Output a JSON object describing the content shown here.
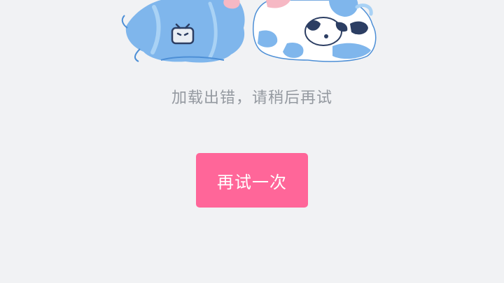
{
  "error_state": {
    "message": "加载出错，请稍后再试",
    "retry_label": "再试一次"
  },
  "illustration": {
    "description_icon": "mascot-illustration",
    "colors": {
      "blue": "#7fb6ec",
      "dark_blue": "#4d8fd6",
      "light_blue": "#a9d2f5",
      "pink": "#f6b8c4",
      "white": "#ffffff",
      "navy": "#2c3e63"
    }
  },
  "theme": {
    "background": "#f1f2f4",
    "accent": "#ff6699",
    "text_muted": "#9499a0"
  }
}
